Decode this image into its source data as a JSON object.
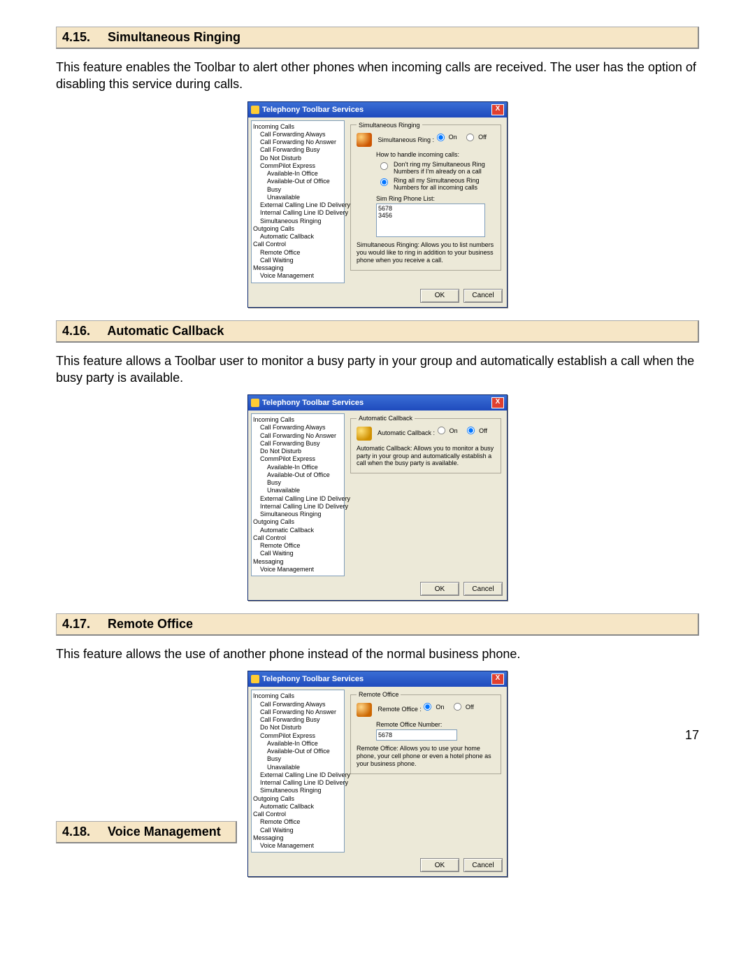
{
  "page_number": "17",
  "sections": [
    {
      "num": "4.15.",
      "title": "Simultaneous Ringing",
      "body": "This feature enables the Toolbar to alert other phones when incoming calls are received. The user has the option of disabling this service during calls."
    },
    {
      "num": "4.16.",
      "title": "Automatic Callback",
      "body": "This feature allows a Toolbar user to monitor a busy party in your group and automatically establish a call when the busy party is available."
    },
    {
      "num": "4.17.",
      "title": "Remote Office",
      "body": "This feature allows the use of another phone instead of the normal business phone."
    },
    {
      "num": "4.18.",
      "title": "Voice Management",
      "body": ""
    }
  ],
  "dialog_common": {
    "title": "Telephony Toolbar Services",
    "close": "X",
    "ok": "OK",
    "cancel": "Cancel",
    "on": "On",
    "off": "Off"
  },
  "tree_items": {
    "l1_incoming": "Incoming Calls",
    "l2_cfa": "Call Forwarding Always",
    "l2_cfna": "Call Forwarding No Answer",
    "l2_cfb": "Call Forwarding Busy",
    "l2_dnd": "Do Not Disturb",
    "l2_cpe": "CommPilot Express",
    "l3_aio": "Available-In Office",
    "l3_aoo": "Available-Out of Office",
    "l3_busy": "Busy",
    "l3_unav": "Unavailable",
    "l2_eclid": "External Calling Line ID Delivery",
    "l2_iclid": "Internal Calling Line ID Delivery",
    "l2_sr": "Simultaneous Ringing",
    "l1_outgoing": "Outgoing Calls",
    "l2_ac": "Automatic Callback",
    "l1_cc": "Call Control",
    "l2_ro": "Remote Office",
    "l2_cw": "Call Waiting",
    "l1_msg": "Messaging",
    "l2_vm": "Voice Management"
  },
  "dlg_sr": {
    "legend": "Simultaneous Ringing",
    "label": "Simultaneous Ring :",
    "sub": "How to handle incoming calls:",
    "opt1": "Don't ring my Simultaneous Ring Numbers if I'm already on a call",
    "opt2": "Ring all my Simultaneous Ring Numbers for all incoming calls",
    "list_label": "Sim Ring Phone List:",
    "list_values": "5678\n3456",
    "desc": "Simultaneous Ringing: Allows you to list numbers you would like to ring in addition to your business phone when you receive a call."
  },
  "dlg_ac": {
    "legend": "Automatic Callback",
    "label": "Automatic Callback :",
    "desc": "Automatic Callback: Allows you to monitor a busy party in your group and automatically establish a call when the busy party is available."
  },
  "dlg_ro": {
    "legend": "Remote Office",
    "label": "Remote Office :",
    "num_label": "Remote Office Number:",
    "num_value": "5678",
    "desc": "Remote Office: Allows you to use your home phone, your cell phone or even a hotel phone as your business phone."
  }
}
